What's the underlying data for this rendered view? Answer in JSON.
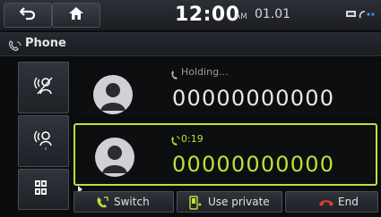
{
  "status_bar": {
    "time": "12:00",
    "ampm": "AM",
    "date": "01.01",
    "back_icon": "back-arrow-icon",
    "home_icon": "home-icon",
    "indicator_icons": [
      "bluetooth-battery-icon",
      "phone-signal-icon"
    ]
  },
  "title_bar": {
    "title": "Phone",
    "icon": "phone-handset-icon"
  },
  "side_buttons": [
    {
      "icon": "mute-mic-icon"
    },
    {
      "icon": "mic-volume-icon"
    },
    {
      "icon": "keypad-icon"
    }
  ],
  "calls": [
    {
      "status": "Holding...",
      "number": "00000000000",
      "state": "holding"
    },
    {
      "status": "0:19",
      "number": "00000000000",
      "state": "active"
    }
  ],
  "actions": {
    "switch_label": "Switch",
    "private_label": "Use private",
    "end_label": "End"
  },
  "colors": {
    "accent": "#b9e23c",
    "end_red": "#e23a2a",
    "text": "#e6e6e6"
  }
}
